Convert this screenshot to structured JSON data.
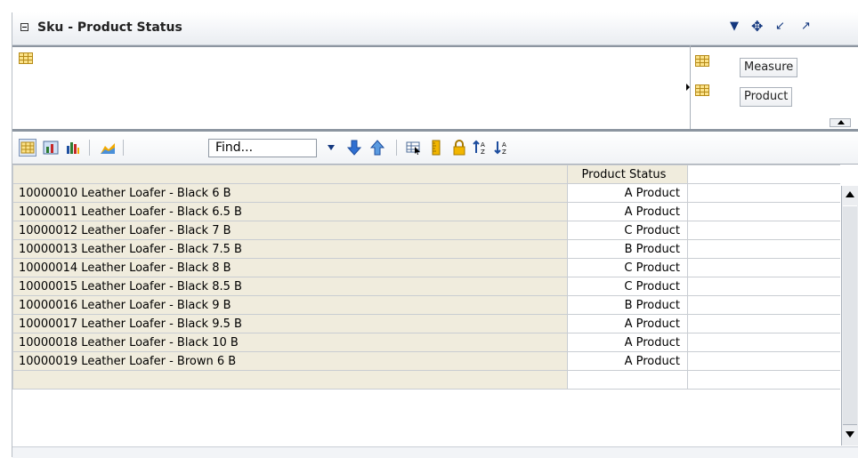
{
  "header": {
    "title": "Sku - Product Status"
  },
  "layout": {
    "dims": [
      "Measure",
      "Product"
    ]
  },
  "toolbar": {
    "find_placeholder": "Find..."
  },
  "table": {
    "column_header": "Product Status",
    "rows": [
      {
        "name": "10000010 Leather Loafer - Black 6 B",
        "status": "A Product"
      },
      {
        "name": "10000011 Leather Loafer - Black 6.5 B",
        "status": "A Product"
      },
      {
        "name": "10000012 Leather Loafer - Black 7 B",
        "status": "C Product"
      },
      {
        "name": "10000013 Leather Loafer - Black 7.5 B",
        "status": "B Product"
      },
      {
        "name": "10000014 Leather Loafer - Black 8 B",
        "status": "C Product"
      },
      {
        "name": "10000015 Leather Loafer - Black 8.5 B",
        "status": "C Product"
      },
      {
        "name": "10000016 Leather Loafer - Black 9 B",
        "status": "B Product"
      },
      {
        "name": "10000017 Leather Loafer - Black 9.5 B",
        "status": "A Product"
      },
      {
        "name": "10000018 Leather Loafer - Black 10 B",
        "status": "A Product"
      },
      {
        "name": "10000019 Leather Loafer - Brown 6 B",
        "status": "A Product"
      }
    ]
  }
}
